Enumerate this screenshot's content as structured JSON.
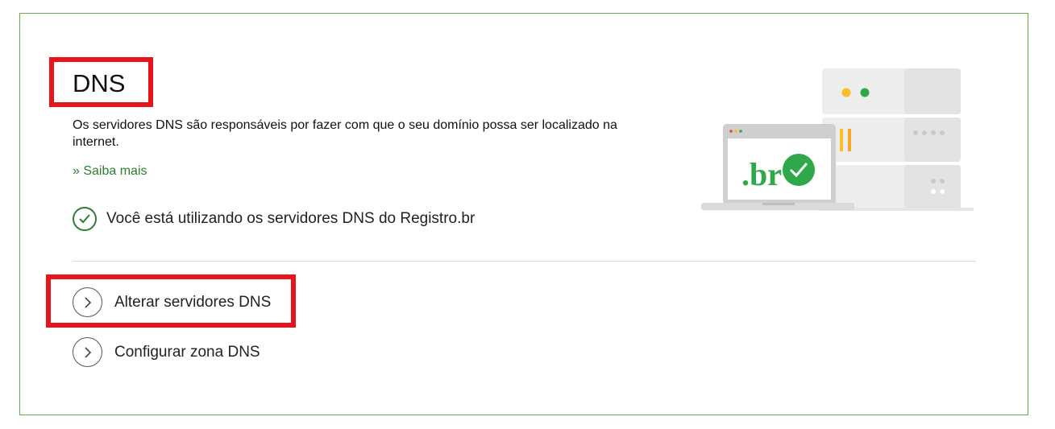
{
  "dns_panel": {
    "title": "DNS",
    "description": "Os servidores DNS são responsáveis por fazer com que o seu domínio possa ser localizado na internet.",
    "learn_more": "» Saiba mais",
    "status_text": "Você está utilizando os servidores DNS do Registro.br",
    "actions": [
      {
        "label": "Alterar servidores DNS",
        "icon": "chevron-right-icon"
      },
      {
        "label": "Configurar zona DNS",
        "icon": "chevron-right-icon"
      }
    ],
    "illustration": {
      "laptop_text": ".br",
      "icons": [
        "server-icon",
        "laptop-icon",
        "check-icon"
      ]
    }
  },
  "colors": {
    "accent_green": "#2e7d32",
    "highlight_red": "#e8141c",
    "border_green": "#6aa84f",
    "server_yellow": "#f9bd25",
    "server_green": "#2fa84a"
  }
}
